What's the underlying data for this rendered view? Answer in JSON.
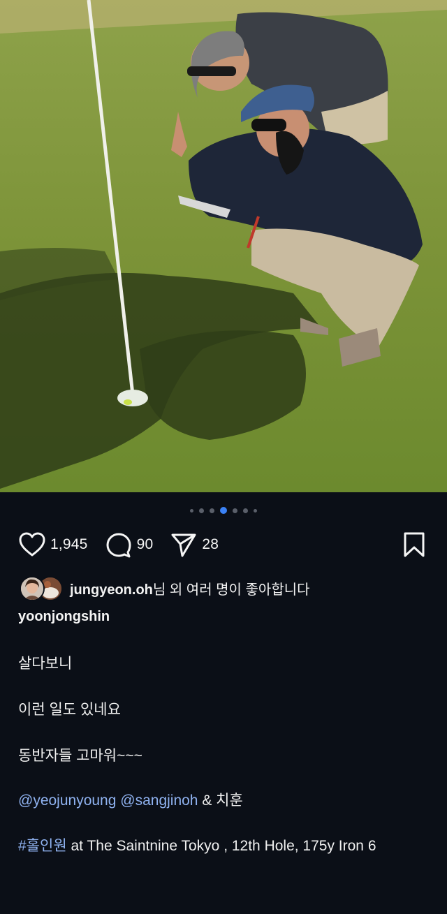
{
  "post": {
    "carousel": {
      "total": 7,
      "active_index": 3
    },
    "actions": {
      "like_count": "1,945",
      "comment_count": "90",
      "share_count": "28"
    },
    "liked_by": {
      "user": "jungyeon.oh",
      "suffix": "님 외 여러 명이 좋아합니다"
    },
    "author": "yoonjongshin",
    "caption": {
      "line1": "살다보니",
      "line2": "이런 일도 있네요",
      "line3": "동반자들 고마워~~~",
      "mention1": "@yeojunyoung",
      "mention2": "@sangjinoh",
      "line4_rest": "& 치훈",
      "hashtag": "#홀인원",
      "location_rest": "at The Saintnine Tokyo , 12th Hole, 175y Iron 6"
    },
    "icons": {
      "like": "heart-icon",
      "comment": "comment-icon",
      "share": "send-icon",
      "save": "bookmark-icon"
    },
    "colors": {
      "background": "#0b0f17",
      "accent_dot": "#3b82f6",
      "link": "#8fb2f0"
    }
  }
}
